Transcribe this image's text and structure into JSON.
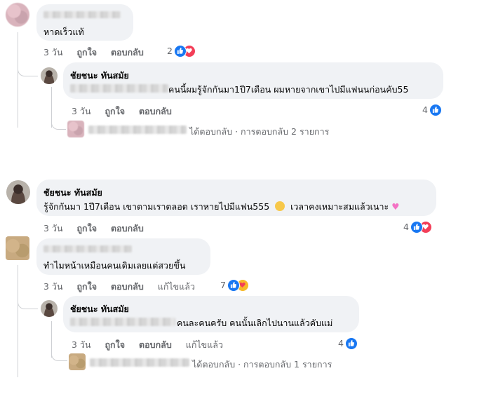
{
  "c1": {
    "text": "หาดเร็วแท้",
    "time": "3 วัน",
    "like": "ถูกใจ",
    "reply": "ตอบกลับ",
    "count": "2"
  },
  "r1": {
    "name": "ชัยชนะ ทันสมัย",
    "text": "คนนี้ผมรู้จักกันมา1ปี7เดือน ผมหายจากเขาไปมีแฟนนก่อนคับ55",
    "time": "3 วัน",
    "like": "ถูกใจ",
    "reply": "ตอบกลับ",
    "count": "4",
    "more": "ได้ตอบกลับ · การตอบกลับ 2 รายการ"
  },
  "c2": {
    "name": "ชัยชนะ ทันสมัย",
    "text": "รู้จักกันมา 1ปี7เดือน เขาตามเราตลอด เราหายไปมีแฟน555",
    "text2": "เวลาคงเหมาะสมแล้วเนาะ",
    "time": "3 วัน",
    "like": "ถูกใจ",
    "reply": "ตอบกลับ",
    "count": "4"
  },
  "c3": {
    "text": "ทำไมหน้าเหมือนคนเดิมเลยแต่สวยขึ้น",
    "time": "3 วัน",
    "like": "ถูกใจ",
    "reply": "ตอบกลับ",
    "edited": "แก้ไขแล้ว",
    "count": "7"
  },
  "r2": {
    "name": "ชัยชนะ ทันสมัย",
    "text": "คนละคนครับ คนนั้นเลิกไปนานแล้วคับแม่",
    "time": "3 วัน",
    "like": "ถูกใจ",
    "reply": "ตอบกลับ",
    "edited": "แก้ไขแล้ว",
    "count": "4",
    "more": "ได้ตอบกลับ · การตอบกลับ 1 รายการ"
  },
  "colors": {
    "like": "#1877f2",
    "love": "#f33e58",
    "care": "#f7b928",
    "bubble": "#f0f2f5",
    "meta": "#65676b"
  }
}
